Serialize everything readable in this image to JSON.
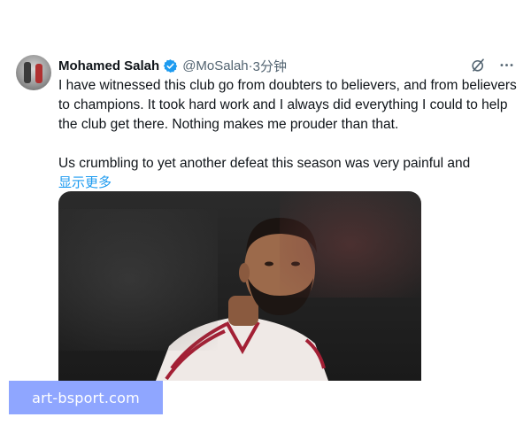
{
  "tweet": {
    "author_name": "Mohamed Salah",
    "handle": "@MoSalah",
    "separator": " · ",
    "time": "3分钟",
    "paragraph1": "I have witnessed this club go from doubters to believers, and from believers to champions. It took hard work and I always did everything I could to help the club get there. Nothing makes me prouder than that.",
    "paragraph2": "Us crumbling to yet another defeat this season was very painful and",
    "show_more_label": "显示更多"
  },
  "icons": {
    "verified": "verified-badge-icon",
    "grok": "grok-icon",
    "more": "more-icon"
  },
  "colors": {
    "accent": "#1d9bf0",
    "text_primary": "#0f1419",
    "text_secondary": "#536471",
    "watermark_bg": "#8fa6ff"
  },
  "watermark": {
    "text": "art-bsport.com"
  }
}
